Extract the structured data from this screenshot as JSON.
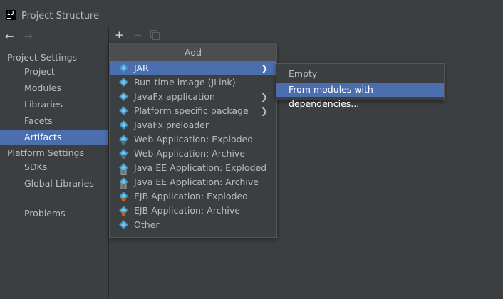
{
  "window": {
    "title": "Project Structure",
    "icon": "intellij-idea-icon",
    "icon_text": "IJ"
  },
  "navigation": {
    "back_icon": "←",
    "forward_icon": "→"
  },
  "sidebar": {
    "project_settings_header": "Project Settings",
    "project_settings": [
      {
        "label": "Project"
      },
      {
        "label": "Modules"
      },
      {
        "label": "Libraries"
      },
      {
        "label": "Facets"
      },
      {
        "label": "Artifacts",
        "selected": true
      }
    ],
    "platform_settings_header": "Platform Settings",
    "platform_settings": [
      {
        "label": "SDKs"
      },
      {
        "label": "Global Libraries"
      }
    ],
    "problems": "Problems"
  },
  "toolbar": {
    "add": "+",
    "remove": "−",
    "copy_icon": "copy-icon"
  },
  "add_popup": {
    "title": "Add",
    "items": [
      {
        "label": "JAR",
        "has_submenu": true,
        "selected": true
      },
      {
        "label": "Run-time image (JLink)"
      },
      {
        "label": "JavaFx application",
        "has_submenu": true
      },
      {
        "label": "Platform specific package",
        "has_submenu": true
      },
      {
        "label": "JavaFx preloader"
      },
      {
        "label": "Web Application: Exploded"
      },
      {
        "label": "Web Application: Archive"
      },
      {
        "label": "Java EE Application: Exploded"
      },
      {
        "label": "Java EE Application: Archive"
      },
      {
        "label": "EJB Application: Exploded"
      },
      {
        "label": "EJB Application: Archive"
      },
      {
        "label": "Other"
      }
    ]
  },
  "jar_submenu": {
    "items": [
      {
        "label": "Empty"
      },
      {
        "label": "From modules with dependencies...",
        "selected": true
      }
    ]
  },
  "colors": {
    "background": "#3c3f41",
    "selection": "#4b6eaf",
    "text": "#bbbbbb",
    "icon_blue": "#3f9ac9"
  }
}
